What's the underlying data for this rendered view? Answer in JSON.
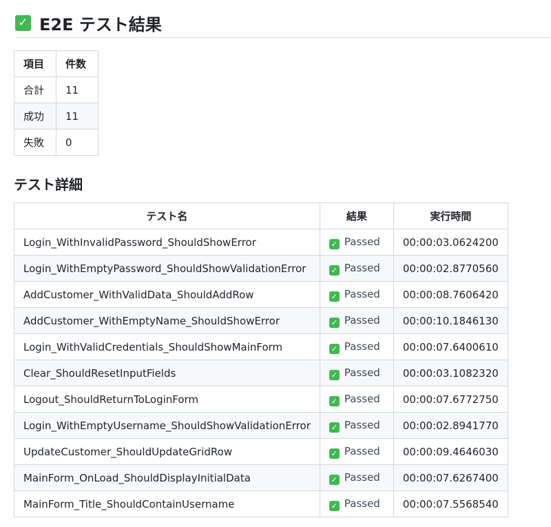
{
  "heading": {
    "icon": "check-mark-button-icon",
    "title": "E2E テスト結果"
  },
  "summary": {
    "headers": [
      "項目",
      "件数"
    ],
    "rows": [
      {
        "label": "合計",
        "count": "11"
      },
      {
        "label": "成功",
        "count": "11"
      },
      {
        "label": "失敗",
        "count": "0"
      }
    ]
  },
  "details": {
    "title": "テスト詳細",
    "headers": [
      "テスト名",
      "結果",
      "実行時間"
    ],
    "rows": [
      {
        "name": "Login_WithInvalidPassword_ShouldShowError",
        "result": "Passed",
        "duration": "00:00:03.0624200"
      },
      {
        "name": "Login_WithEmptyPassword_ShouldShowValidationError",
        "result": "Passed",
        "duration": "00:00:02.8770560"
      },
      {
        "name": "AddCustomer_WithValidData_ShouldAddRow",
        "result": "Passed",
        "duration": "00:00:08.7606420"
      },
      {
        "name": "AddCustomer_WithEmptyName_ShouldShowError",
        "result": "Passed",
        "duration": "00:00:10.1846130"
      },
      {
        "name": "Login_WithValidCredentials_ShouldShowMainForm",
        "result": "Passed",
        "duration": "00:00:07.6400610"
      },
      {
        "name": "Clear_ShouldResetInputFields",
        "result": "Passed",
        "duration": "00:00:03.1082320"
      },
      {
        "name": "Logout_ShouldReturnToLoginForm",
        "result": "Passed",
        "duration": "00:00:07.6772750"
      },
      {
        "name": "Login_WithEmptyUsername_ShouldShowValidationError",
        "result": "Passed",
        "duration": "00:00:02.8941770"
      },
      {
        "name": "UpdateCustomer_ShouldUpdateGridRow",
        "result": "Passed",
        "duration": "00:00:09.4646030"
      },
      {
        "name": "MainForm_OnLoad_ShouldDisplayInitialData",
        "result": "Passed",
        "duration": "00:00:07.6267400"
      },
      {
        "name": "MainForm_Title_ShouldContainUsername",
        "result": "Passed",
        "duration": "00:00:07.5568540"
      }
    ]
  },
  "colors": {
    "check_green": "#3fb950",
    "border": "#d0d7de",
    "stripe": "#f6f8fa"
  }
}
